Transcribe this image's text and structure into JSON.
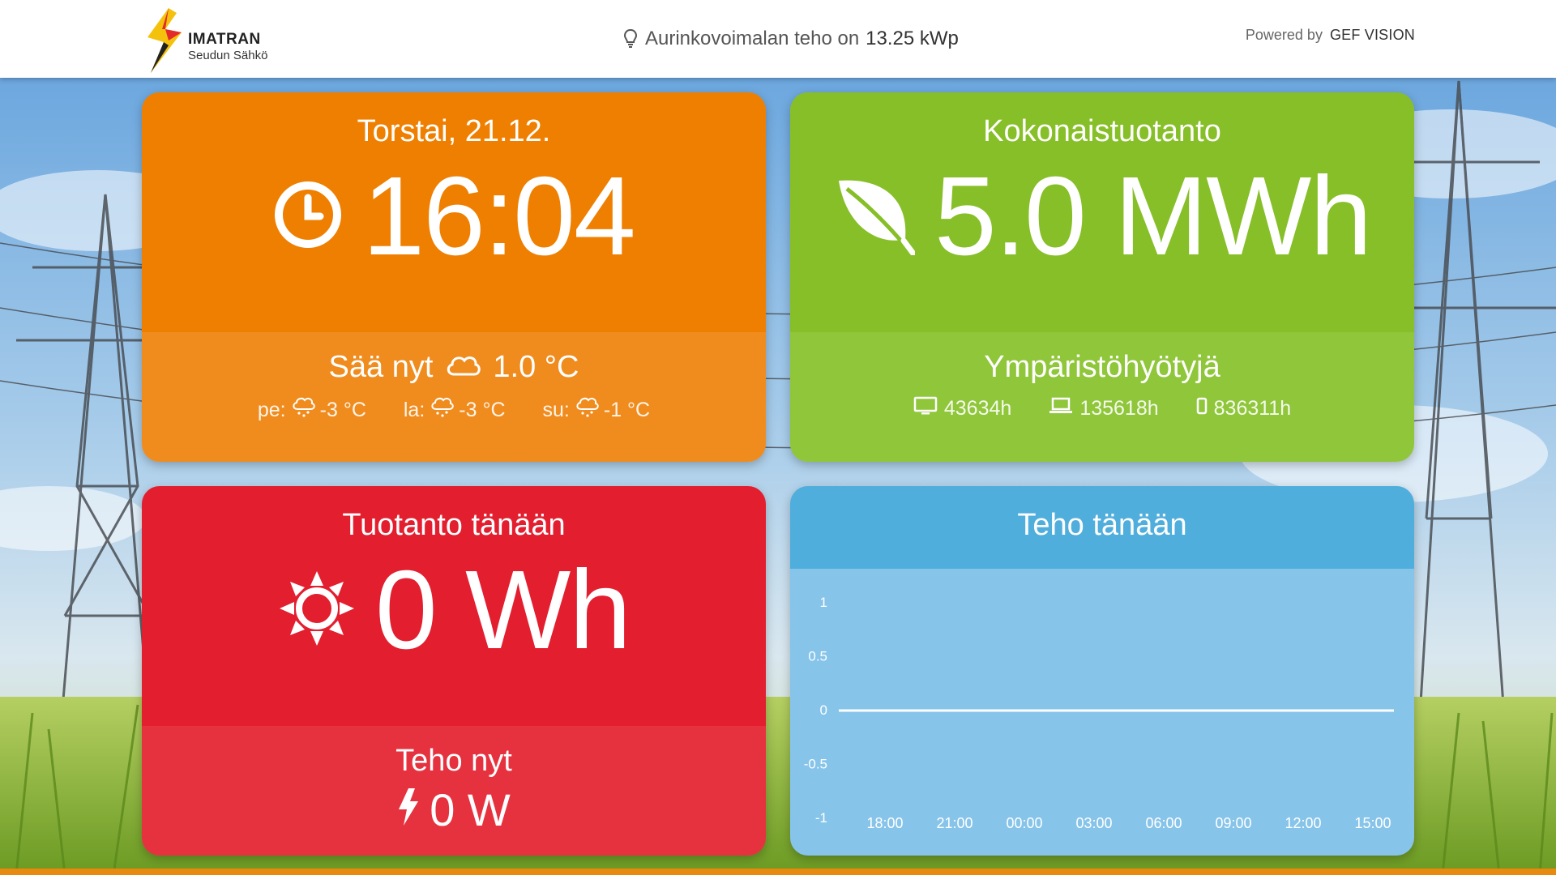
{
  "header": {
    "brand": "IMATRAN",
    "brand_sub": "Seudun Sähkö",
    "info_text": "Aurinkovoimalan teho on",
    "info_value": "13.25 kWp",
    "powered_by": "Powered by",
    "vendor": "GEF VISION"
  },
  "time_card": {
    "date": "Torstai, 21.12.",
    "time": "16:04",
    "weather_label": "Sää nyt",
    "weather_temp": "1.0 °C",
    "forecast": [
      {
        "day": "pe:",
        "temp": "-3 °C"
      },
      {
        "day": "la:",
        "temp": "-3 °C"
      },
      {
        "day": "su:",
        "temp": "-1 °C"
      }
    ]
  },
  "total_card": {
    "title": "Kokonaistuotanto",
    "value": "5.0 MWh",
    "benefits_title": "Ympäristöhyötyjä",
    "equivalents": [
      {
        "icon": "monitor-icon",
        "value": "43634h"
      },
      {
        "icon": "laptop-icon",
        "value": "135618h"
      },
      {
        "icon": "phone-icon",
        "value": "836311h"
      }
    ]
  },
  "today_card": {
    "title": "Tuotanto tänään",
    "value": "0 Wh",
    "power_label": "Teho nyt",
    "power_value": "0 W"
  },
  "chart_card": {
    "title": "Teho tänään"
  },
  "colors": {
    "orange": "#ef7f00",
    "green": "#86bf27",
    "red": "#e31e2f",
    "blue": "#50aedd"
  },
  "chart_data": {
    "type": "line",
    "title": "Teho tänään",
    "x": [
      "18:00",
      "21:00",
      "00:00",
      "03:00",
      "06:00",
      "09:00",
      "12:00",
      "15:00"
    ],
    "yticks": [
      "1",
      "0.5",
      "0",
      "-0.5",
      "-1"
    ],
    "ylim": [
      -1,
      1
    ],
    "series": [
      {
        "values": [
          0,
          0,
          0,
          0,
          0,
          0,
          0,
          0
        ]
      }
    ],
    "grid": false
  }
}
